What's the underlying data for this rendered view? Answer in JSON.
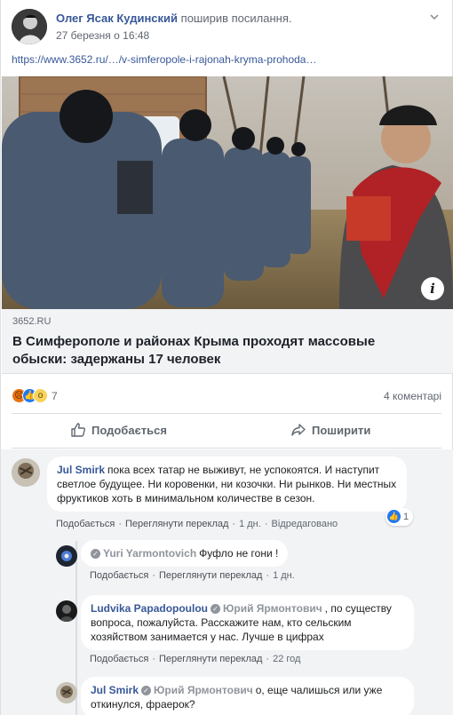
{
  "post": {
    "author": "Олег Ясак Кудинский",
    "action": "поширив посилання.",
    "timestamp": "27 березня о 16:48",
    "link_text": "https://www.3652.ru/…/v-simferopole-i-rajonah-kryma-prohoda…"
  },
  "link_preview": {
    "domain": "3652.RU",
    "title": "В Симферополе и районах Крыма проходят массовые обыски: задержаны 17 человек",
    "image_description": "Росгвардия в масках стоит в ряд на сельской улице, справа пожилая женщина с красным шарфом",
    "info_icon": "i"
  },
  "reactions": {
    "icons": [
      "angry-icon",
      "like-icon",
      "wow-icon"
    ],
    "count": "7",
    "comments_count": "4 коментарі"
  },
  "actions": {
    "like_label": "Подобається",
    "share_label": "Поширити"
  },
  "comments": [
    {
      "author": "Jul Smirk",
      "text": "пока всех татар не выживут, не успокоятся. И наступит светлое будущее. Ни коровенки, ни козочки. Ни рынков. Ни местных фруктиков хоть в минимальном количестве в сезон.",
      "like": "Подобається",
      "translate": "Переглянути переклад",
      "time": "1 дн.",
      "edited": "Відредаговано",
      "like_count": "1"
    },
    {
      "author": "",
      "mention": "Yuri Yarmontovich",
      "text": "Фуфло не гони !",
      "like": "Подобається",
      "translate": "Переглянути переклад",
      "time": "1 дн."
    },
    {
      "author": "Ludvika Papadopoulou",
      "mention": "Юрий Ярмонтович",
      "text": ", по существу вопроса, пожалуйста. Расскажите нам, кто сельским хозяйством занимается у нас. Лучше в цифрах",
      "like": "Подобається",
      "translate": "Переглянути переклад",
      "time": "22 год"
    },
    {
      "author": "Jul Smirk",
      "mention": "Юрий Ярмонтович",
      "text": "о, еще чалишься или уже откинулся, фраерок?"
    }
  ],
  "colors": {
    "link_blue": "#385898",
    "like_blue": "#2078f4",
    "comments_bg": "#f2f3f5"
  }
}
